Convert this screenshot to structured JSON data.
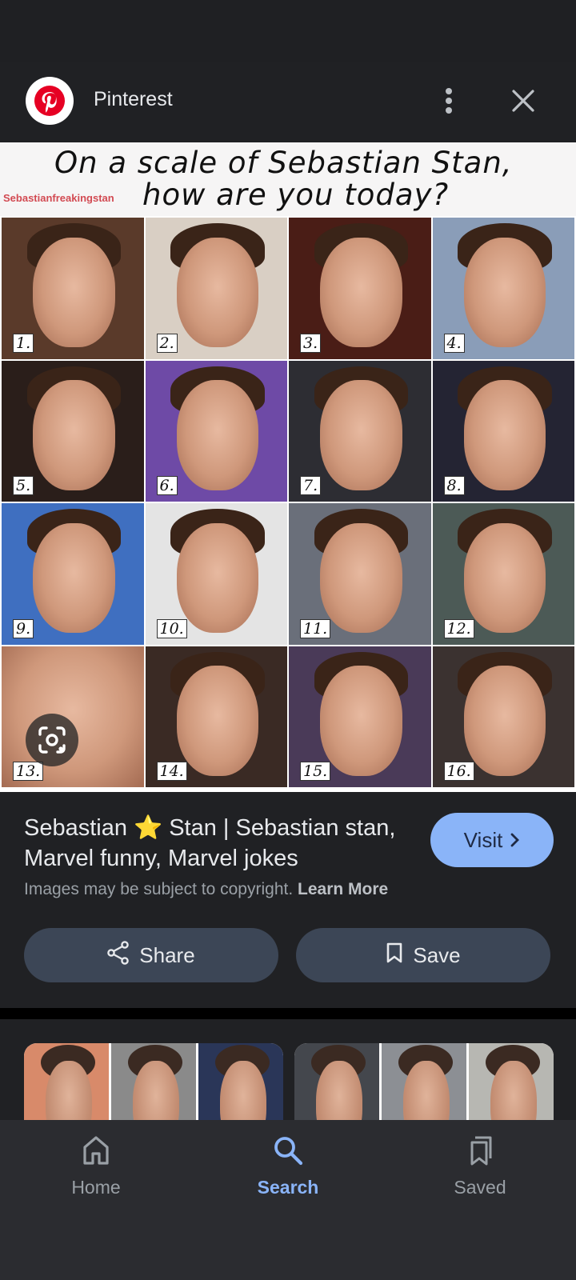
{
  "top_bar": {
    "site_name": "Pinterest"
  },
  "hero": {
    "title_line1": "On a scale of Sebastian Stan,",
    "title_line2": "how are you today?",
    "watermark": "Sebastianfreakingstan",
    "numbers": [
      "1.",
      "2.",
      "3.",
      "4.",
      "5.",
      "6.",
      "7.",
      "8.",
      "9.",
      "10.",
      "11.",
      "12.",
      "13.",
      "14.",
      "15.",
      "16."
    ]
  },
  "info": {
    "title": "Sebastian ⭐ Stan | Sebastian stan, Marvel funny, Marvel jokes",
    "visit_label": "Visit",
    "copyright_text": "Images may be subject to copyright.",
    "learn_more": "Learn More",
    "share_label": "Share",
    "save_label": "Save"
  },
  "bottom_nav": {
    "items": [
      {
        "label": "Home",
        "icon": "home-icon"
      },
      {
        "label": "Search",
        "icon": "search-icon"
      },
      {
        "label": "Saved",
        "icon": "bookmarks-icon"
      }
    ],
    "active": "Search"
  },
  "colors": {
    "accent": "#8ab4f8",
    "background": "#202124",
    "button": "#3c4656",
    "pinterest_red": "#e60023"
  }
}
